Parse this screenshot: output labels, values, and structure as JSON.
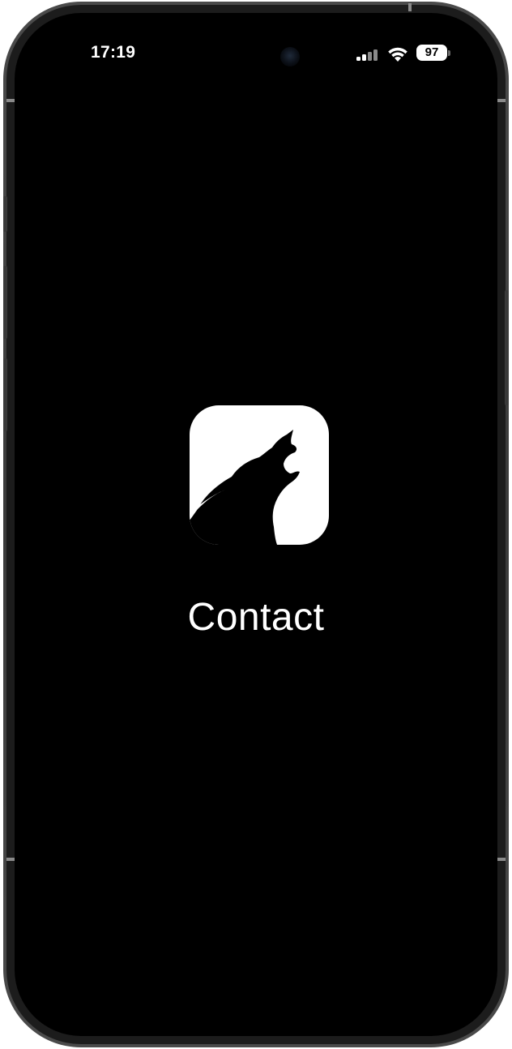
{
  "status_bar": {
    "time": "17:19",
    "battery_level": "97",
    "icons": [
      "signal-icon",
      "wifi-icon",
      "battery-icon"
    ]
  },
  "splash": {
    "logo_icon": "howling-wolf-logo-icon",
    "app_name": "Contact"
  },
  "colors": {
    "background": "#000000",
    "foreground": "#ffffff",
    "bezel": "#3a3a3a"
  }
}
